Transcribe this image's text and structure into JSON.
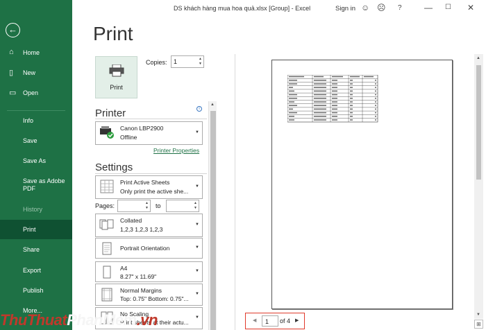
{
  "window": {
    "title": "DS khách hàng mua hoa quả.xlsx  [Group]  -  Excel",
    "sign_in": "Sign in"
  },
  "sidebar": {
    "items": [
      {
        "label": "Home"
      },
      {
        "label": "New"
      },
      {
        "label": "Open"
      },
      {
        "label": "Info"
      },
      {
        "label": "Save"
      },
      {
        "label": "Save As"
      },
      {
        "label": "Save as Adobe PDF"
      },
      {
        "label": "History"
      },
      {
        "label": "Print"
      },
      {
        "label": "Share"
      },
      {
        "label": "Export"
      },
      {
        "label": "Publish"
      },
      {
        "label": "More..."
      }
    ]
  },
  "main": {
    "title": "Print",
    "print_button": "Print",
    "copies_label": "Copies:",
    "copies_value": "1",
    "printer_header": "Printer",
    "printer_name": "Canon LBP2900",
    "printer_status": "Offline",
    "printer_properties": "Printer Properties",
    "settings_header": "Settings",
    "settings": [
      {
        "line1": "Print Active Sheets",
        "line2": "Only print the active she..."
      },
      {
        "line1": "Collated",
        "line2": "1,2,3    1,2,3    1,2,3"
      },
      {
        "line1": "Portrait Orientation",
        "line2": ""
      },
      {
        "line1": "A4",
        "line2": "8.27\" x 11.69\""
      },
      {
        "line1": "Normal Margins",
        "line2": "Top: 0.75\" Bottom: 0.75\"..."
      },
      {
        "line1": "No Scaling",
        "line2": "Print sheets at their actu..."
      }
    ],
    "pages_label": "Pages:",
    "to_label": "to"
  },
  "preview": {
    "page_current": "1",
    "page_total": "of 4"
  },
  "watermark": {
    "part1": "ThuThuat",
    "part2": "PhanMem",
    "part3": ".vn"
  }
}
